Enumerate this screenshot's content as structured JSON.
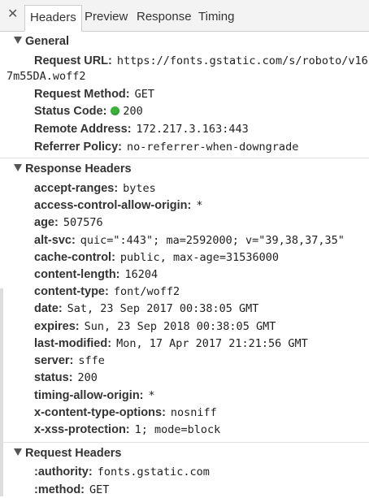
{
  "tabs": [
    {
      "label": "Headers"
    },
    {
      "label": "Preview"
    },
    {
      "label": "Response"
    },
    {
      "label": "Timing"
    }
  ],
  "general": {
    "title": "General",
    "request_url_label": "Request URL:",
    "request_url_value": "https://fonts.gstatic.com/s/roboto/v16",
    "request_url_wrap": "7m55DA.woff2",
    "request_method_label": "Request Method:",
    "request_method_value": "GET",
    "status_code_label": "Status Code:",
    "status_code_value": "200",
    "status_color": "#3cb43c",
    "remote_address_label": "Remote Address:",
    "remote_address_value": "172.217.3.163:443",
    "referrer_policy_label": "Referrer Policy:",
    "referrer_policy_value": "no-referrer-when-downgrade"
  },
  "response_headers": {
    "title": "Response Headers",
    "items": [
      {
        "key": "accept-ranges:",
        "value": "bytes"
      },
      {
        "key": "access-control-allow-origin:",
        "value": "*"
      },
      {
        "key": "age:",
        "value": "507576"
      },
      {
        "key": "alt-svc:",
        "value": "quic=\":443\"; ma=2592000; v=\"39,38,37,35\""
      },
      {
        "key": "cache-control:",
        "value": "public, max-age=31536000"
      },
      {
        "key": "content-length:",
        "value": "16204"
      },
      {
        "key": "content-type:",
        "value": "font/woff2"
      },
      {
        "key": "date:",
        "value": "Sat, 23 Sep 2017 00:38:05 GMT"
      },
      {
        "key": "expires:",
        "value": "Sun, 23 Sep 2018 00:38:05 GMT"
      },
      {
        "key": "last-modified:",
        "value": "Mon, 17 Apr 2017 21:21:56 GMT"
      },
      {
        "key": "server:",
        "value": "sffe"
      },
      {
        "key": "status:",
        "value": "200"
      },
      {
        "key": "timing-allow-origin:",
        "value": "*"
      },
      {
        "key": "x-content-type-options:",
        "value": "nosniff"
      },
      {
        "key": "x-xss-protection:",
        "value": "1; mode=block"
      }
    ]
  },
  "request_headers": {
    "title": "Request Headers",
    "items": [
      {
        "key": ":authority:",
        "value": "fonts.gstatic.com"
      },
      {
        "key": ":method:",
        "value": "GET"
      }
    ]
  }
}
